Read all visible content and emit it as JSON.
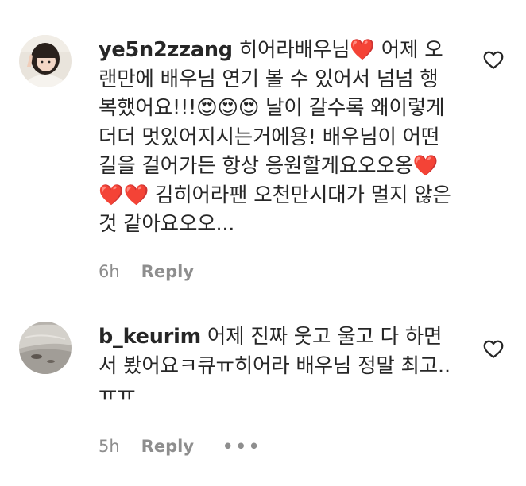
{
  "comments": [
    {
      "username": "ye5n2zzang",
      "segments": [
        "히어라배우님",
        "❤️",
        " 어제 오랜만에 배우님 연기 볼 수 있어서 넘넘 행복했어요!!!",
        "😍😍😍",
        " 날이 갈수록 왜이렇게 더더 멋있어지시는거에용! 배우님이 어떤 길을 걸어가든 항상 응원할게요오오옹",
        "❤️❤️❤️",
        " 김히어라팬 오천만시대가 멀지 않은 것 같아요오오..."
      ],
      "time": "6h",
      "reply_label": "Reply",
      "avatar_icon": "profile-photo-girl"
    },
    {
      "username": "b_keurim",
      "segments": [
        "어제 진짜 웃고 울고 다 하면서 봤어요ㅋ큐ㅠ히어라 배우님 정말 최고..ㅠㅠ"
      ],
      "time": "5h",
      "reply_label": "Reply",
      "more_label": "•••",
      "avatar_icon": "profile-photo-landscape"
    }
  ],
  "icons": {
    "like": "heart-outline-icon"
  },
  "colors": {
    "text": "#262626",
    "muted": "#8e8e8e",
    "heart_red": "#ed4956"
  }
}
